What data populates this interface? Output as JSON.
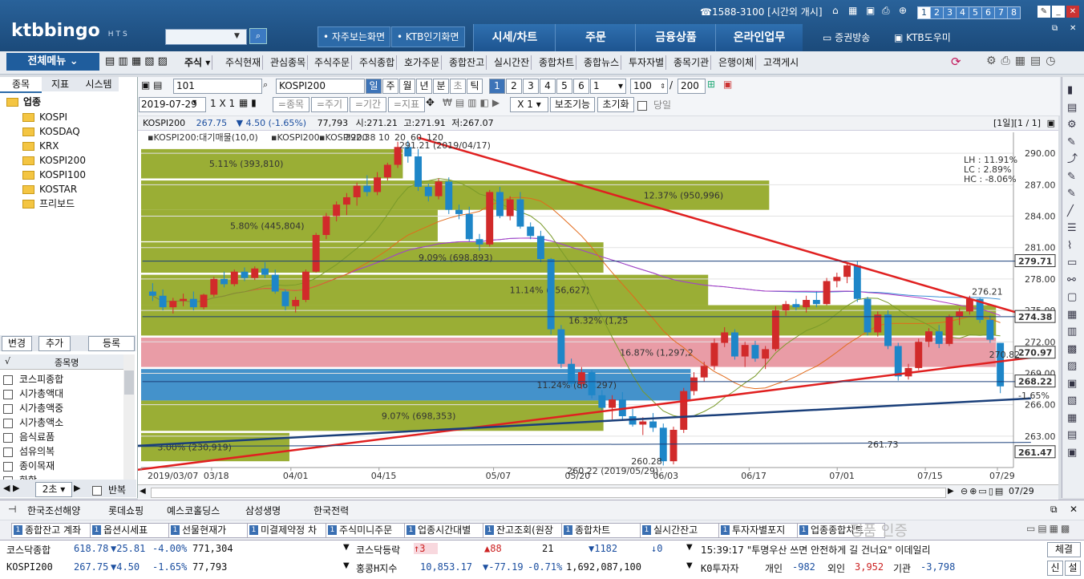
{
  "header": {
    "logo": "ktbbingo",
    "logo_sub": "HTS",
    "hotline": "☎1588-3100 [시간외 개시]",
    "screen_numbers": [
      "1",
      "2",
      "3",
      "4",
      "5",
      "6",
      "7",
      "8"
    ],
    "favorite_screen_button": "• 자주보는화면",
    "ktb_popular_button": "• KTB인기화면",
    "main_menu": [
      "시세/차트",
      "주문",
      "금융상품",
      "온라인업무"
    ],
    "broadcast_label": "증권방송",
    "help_label": "KTB도우미"
  },
  "menubar": {
    "all_menu": "전체메뉴",
    "items": [
      "주식",
      "주식현재",
      "관심종목",
      "주식주문",
      "주식종합",
      "호가주문",
      "종합잔고",
      "실시간잔",
      "종합차트",
      "종합뉴스",
      "투자자별",
      "종목기관",
      "은행이체",
      "고객게시"
    ]
  },
  "left_panel": {
    "tabs": [
      "종목",
      "지표",
      "시스템"
    ],
    "tree_root": "업종",
    "tree_items": [
      "KOSPI",
      "KOSDAQ",
      "KRX",
      "KOSPI200",
      "KOSPI100",
      "KOSTAR",
      "프리보드"
    ],
    "buttons": [
      "변경",
      "추가",
      "등록"
    ],
    "list_header": [
      "√",
      "종목명"
    ],
    "list_items": [
      "코스피종합",
      "시가총액대",
      "시가총액중",
      "시가총액소",
      "음식료품",
      "섬유의복",
      "종이목재",
      "화학"
    ],
    "interval_select": "2초",
    "repeat_label": "반복"
  },
  "chart_toolbar": {
    "symbol_code": "101",
    "symbol_name": "KOSPI200",
    "periods": [
      "일",
      "주",
      "월",
      "년",
      "분",
      "초",
      "틱"
    ],
    "selected_period": "일",
    "counts": [
      "1",
      "2",
      "3",
      "4",
      "5",
      "6"
    ],
    "unit_value": "1",
    "bar_count": "100",
    "total_count": "200",
    "date": "2019-07-29",
    "layout": "1 X 1",
    "buttons": [
      "=종목",
      "=주기",
      "=기간",
      "=지표"
    ],
    "zoom": "X 1",
    "aux_button": "보조기능",
    "reset_button": "초기화",
    "sameday_label": "당일"
  },
  "chart_header": {
    "symbol": "KOSPI200",
    "price": "267.75",
    "change": "▼ 4.50 (-1.65%)",
    "volume": "77,793",
    "open": "시:271.21",
    "high": "고:271.91",
    "low": "저:267.07",
    "period_info": "[1일][1 / 1]"
  },
  "chart_legend": {
    "volume_profile": "KOSPI200:대기매물(10,0)",
    "price": "KOSPI200",
    "ma_label": "KOSPI200",
    "ma_periods": [
      "10",
      "20",
      "60",
      "120"
    ],
    "high_mark": "292.38",
    "high_note": "291.21 (2019/04/17)",
    "lh": "LH : 11.91%",
    "lc": "LC : 2.89%",
    "hc": "HC : -8.06%"
  },
  "chart_data": {
    "type": "candlestick",
    "x_ticks": [
      "2019/03/07",
      "03/18",
      "04/01",
      "04/15",
      "05/07",
      "05/20",
      "06/03",
      "06/17",
      "07/01",
      "07/15",
      "07/29"
    ],
    "y_ticks": [
      290.0,
      287.0,
      284.0,
      281.0,
      278.0,
      275.0,
      272.0,
      269.0,
      266.0,
      263.0
    ],
    "ylim": [
      260.0,
      292.0
    ],
    "price_tags": [
      "279.71",
      "274.38",
      "270.97",
      "268.22",
      "261.47"
    ],
    "current_change": "-1.65%",
    "volume_profile": [
      {
        "label": "3.00% (230,919)"
      },
      {
        "label": "9.07% (698,353)"
      },
      {
        "label": "11.24% (864,297)"
      },
      {
        "label": "16.87% (1,297,2"
      },
      {
        "label": "16.32% (1,25"
      },
      {
        "label": "11.14% (856,627)"
      },
      {
        "label": "9.09% (698,893)"
      },
      {
        "label": "5.80% (445,804)"
      },
      {
        "label": "12.37% (950,996)"
      },
      {
        "label": "5.11% (393,810)"
      }
    ],
    "annotations": [
      "260.22 (2019/05/29)",
      "260.28",
      "276.21",
      "261.73",
      "270.82"
    ],
    "candles": [
      [
        276.8,
        277.6,
        275.9,
        276.4
      ],
      [
        276.4,
        277.0,
        275.0,
        275.3
      ],
      [
        275.3,
        276.2,
        274.7,
        275.9
      ],
      [
        275.9,
        276.6,
        275.4,
        276.1
      ],
      [
        276.1,
        276.8,
        275.0,
        275.3
      ],
      [
        275.3,
        276.6,
        275.1,
        276.5
      ],
      [
        276.5,
        278.2,
        276.3,
        278.0
      ],
      [
        278.0,
        278.7,
        277.2,
        277.5
      ],
      [
        277.5,
        278.9,
        277.3,
        278.7
      ],
      [
        278.7,
        279.1,
        277.8,
        278.1
      ],
      [
        278.1,
        279.2,
        277.9,
        279.0
      ],
      [
        279.0,
        279.6,
        278.1,
        278.4
      ],
      [
        278.4,
        278.9,
        276.6,
        276.8
      ],
      [
        276.8,
        277.0,
        275.0,
        275.4
      ],
      [
        275.4,
        276.3,
        274.8,
        276.0
      ],
      [
        276.0,
        278.9,
        275.8,
        278.7
      ],
      [
        278.7,
        282.4,
        278.6,
        282.2
      ],
      [
        282.2,
        284.3,
        281.8,
        284.0
      ],
      [
        284.0,
        285.4,
        283.5,
        285.1
      ],
      [
        285.1,
        286.2,
        284.1,
        285.8
      ],
      [
        285.8,
        287.2,
        285.0,
        286.9
      ],
      [
        286.9,
        287.9,
        285.9,
        286.3
      ],
      [
        286.3,
        288.2,
        286.0,
        287.7
      ],
      [
        287.7,
        289.1,
        287.4,
        288.9
      ],
      [
        288.9,
        291.1,
        288.6,
        290.6
      ],
      [
        290.6,
        291.2,
        289.1,
        289.7
      ],
      [
        289.7,
        290.4,
        286.4,
        286.8
      ],
      [
        286.8,
        287.1,
        285.4,
        285.9
      ],
      [
        285.9,
        287.6,
        285.6,
        287.3
      ],
      [
        287.3,
        287.7,
        284.2,
        284.6
      ],
      [
        284.6,
        285.1,
        283.7,
        284.2
      ],
      [
        284.2,
        284.9,
        281.6,
        281.8
      ],
      [
        281.8,
        282.3,
        280.7,
        281.3
      ],
      [
        281.3,
        286.5,
        281.1,
        286.3
      ],
      [
        286.3,
        286.8,
        283.8,
        284.0
      ],
      [
        284.0,
        285.9,
        283.6,
        285.6
      ],
      [
        285.6,
        286.3,
        282.8,
        283.0
      ],
      [
        283.0,
        283.4,
        281.8,
        282.1
      ],
      [
        282.1,
        282.6,
        279.6,
        279.9
      ],
      [
        279.9,
        280.0,
        272.7,
        273.2
      ],
      [
        273.2,
        273.6,
        269.5,
        269.9
      ],
      [
        269.9,
        270.4,
        267.7,
        268.0
      ],
      [
        268.0,
        269.6,
        267.5,
        269.1
      ],
      [
        269.1,
        269.3,
        266.6,
        266.9
      ],
      [
        266.9,
        267.4,
        265.4,
        265.7
      ],
      [
        265.7,
        266.9,
        264.6,
        266.5
      ],
      [
        266.5,
        267.2,
        264.6,
        264.9
      ],
      [
        264.9,
        265.6,
        263.9,
        264.1
      ],
      [
        264.1,
        264.8,
        263.1,
        264.4
      ],
      [
        264.4,
        265.2,
        263.4,
        263.8
      ],
      [
        263.8,
        264.2,
        260.2,
        260.6
      ],
      [
        260.6,
        263.9,
        260.3,
        263.6
      ],
      [
        263.6,
        267.6,
        263.3,
        267.3
      ],
      [
        267.3,
        269.1,
        266.9,
        268.6
      ],
      [
        268.6,
        270.1,
        268.2,
        269.7
      ],
      [
        269.7,
        272.3,
        269.3,
        271.9
      ],
      [
        271.9,
        273.4,
        271.5,
        272.9
      ],
      [
        272.9,
        273.2,
        270.3,
        270.6
      ],
      [
        270.6,
        272.0,
        269.6,
        271.7
      ],
      [
        271.7,
        272.1,
        270.1,
        270.4
      ],
      [
        270.4,
        271.6,
        269.4,
        271.3
      ],
      [
        271.3,
        275.4,
        271.1,
        275.0
      ],
      [
        275.0,
        275.9,
        274.5,
        275.6
      ],
      [
        275.6,
        276.1,
        275.0,
        275.3
      ],
      [
        275.3,
        276.4,
        274.8,
        276.0
      ],
      [
        276.0,
        276.8,
        275.3,
        275.6
      ],
      [
        275.6,
        278.1,
        275.5,
        277.8
      ],
      [
        277.8,
        278.6,
        277.2,
        278.2
      ],
      [
        278.2,
        279.5,
        277.6,
        279.3
      ],
      [
        279.3,
        279.7,
        275.8,
        276.1
      ],
      [
        276.1,
        276.3,
        272.6,
        272.9
      ],
      [
        272.9,
        274.9,
        272.5,
        274.6
      ],
      [
        274.6,
        275.0,
        271.3,
        271.6
      ],
      [
        271.6,
        271.9,
        268.3,
        268.7
      ],
      [
        268.7,
        269.9,
        268.4,
        269.5
      ],
      [
        269.5,
        272.3,
        269.3,
        272.0
      ],
      [
        272.0,
        273.3,
        271.5,
        273.0
      ],
      [
        273.0,
        273.6,
        271.4,
        271.8
      ],
      [
        271.8,
        274.6,
        271.6,
        274.4
      ],
      [
        274.4,
        275.2,
        273.6,
        274.9
      ],
      [
        274.9,
        276.4,
        274.6,
        276.1
      ],
      [
        276.1,
        276.2,
        273.8,
        274.1
      ],
      [
        274.1,
        274.5,
        271.9,
        272.2
      ],
      [
        271.9,
        271.9,
        267.1,
        267.75
      ]
    ]
  },
  "chart_nav": {
    "end_date": "07/29"
  },
  "bottom": {
    "watch_tabs": [
      "한국조선해양",
      "롯데쇼핑",
      "예스코홀딩스",
      "삼성생명",
      "한국전력"
    ],
    "open_screens": [
      "종합잔고 계좌",
      "옵션시세표",
      "선물현재가",
      "미결제약정 차",
      "주식미니주문",
      "업종시간대별",
      "잔고조회(원장",
      "종합차트",
      "실시간잔고",
      "투자자별포지",
      "업종종합차트"
    ],
    "ticker1": [
      {
        "name": "코스닥종합",
        "price": "618.78",
        "chg": "▼25.81",
        "pct": "-4.00%",
        "vol": "771,304"
      },
      {
        "name": "KOSPI200",
        "price": "267.75",
        "chg": "▼4.50",
        "pct": "-1.65%",
        "vol": "77,793"
      }
    ],
    "kosdaq_breadth": {
      "label": "코스닥등락",
      "up_limit": "↑3",
      "up": "▲88",
      "flat": "21",
      "down": "▼1182",
      "down_limit": "↓0"
    },
    "hangseng": {
      "label": "홍콩H지수",
      "price": "10,853.17",
      "chg": "▼-77.19",
      "pct": "-0.71%",
      "vol": "1,692,087,100"
    },
    "news": {
      "time": "15:39:17",
      "text": "\"투명우산 쓰면 안전하게 길 건너요\" 이데일리",
      "button": "체결"
    },
    "investors": {
      "label": "K0투자자",
      "individual_label": "개인",
      "individual": "-982",
      "foreign_label": "외인",
      "foreign": "3,952",
      "inst_label": "기관",
      "inst": "-3,798",
      "btn1": "신",
      "btn2": "설"
    },
    "watermark": "정품 인증"
  }
}
